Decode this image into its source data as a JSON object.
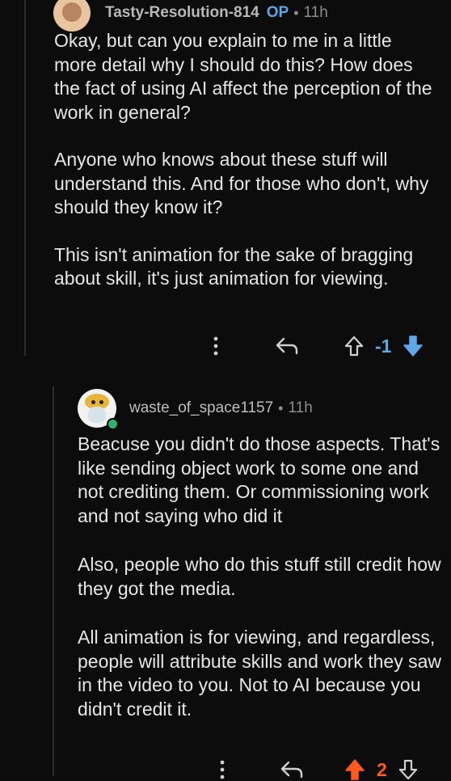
{
  "comments": [
    {
      "username": "Tasty-Resolution-814",
      "badge": "OP",
      "separator": "•",
      "time": "11h",
      "paragraphs": [
        "Okay, but can you explain to me in a little more detail why I should do this? How does the fact of using AI affect the perception of the work in general?",
        "Anyone who knows about these stuff will understand this. And for those who don't, why should they know it?",
        "This isn't animation for the sake of bragging about skill, it's just animation for viewing."
      ],
      "actions": {
        "more_icon": "more-vertical-icon",
        "reply_icon": "reply-arrow-icon",
        "score": "-1",
        "score_color": "#5ea7e8",
        "upvote_state": "neutral",
        "downvote_state": "active"
      }
    },
    {
      "username": "waste_of_space1157",
      "separator": "•",
      "time": "11h",
      "online": true,
      "paragraphs": [
        "Beacuse you didn't do those aspects. That's like sending object work to some one and not crediting them. Or commissioning work and not saying who did it",
        "Also, people who do this stuff still credit how they got the media.",
        "All animation is for viewing, and regardless, people will attribute skills and work they saw in the video to you. Not to AI because you didn't credit it."
      ],
      "actions": {
        "more_icon": "more-vertical-icon",
        "reply_icon": "reply-arrow-icon",
        "score": "2",
        "score_color": "#ff5a1f",
        "upvote_state": "active",
        "downvote_state": "neutral"
      }
    }
  ],
  "colors": {
    "background": "#0c0c0c",
    "text": "#e6e6e6",
    "meta": "#8c8c8c",
    "op_badge": "#5ea7e8",
    "downvote_active": "#5ea7e8",
    "upvote_active": "#ff5a1f",
    "online": "#2fb36b"
  }
}
